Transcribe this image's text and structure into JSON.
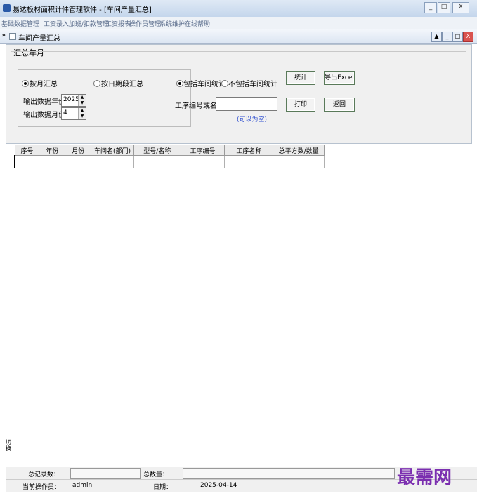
{
  "app": {
    "title": "易达板材面积计件管理软件  - [车间产量汇总]",
    "window_controls": {
      "minimize": "_",
      "maximize": "□",
      "close": "X"
    }
  },
  "menu": {
    "items": [
      "基础数据管理",
      "工资录入",
      "加班/扣款管理",
      "工资报表",
      "操作员管理",
      "系统维护",
      "在线帮助"
    ]
  },
  "child": {
    "nav": "»",
    "title": "车间产量汇总",
    "controls": {
      "restore": "▲",
      "minimize": "_",
      "maximize": "□",
      "close": "X"
    }
  },
  "form": {
    "group_title": "汇总年月",
    "radio_month": "按月汇总",
    "radio_date": "按日期段汇总",
    "year_label": "输出数据年份",
    "year_value": "2025",
    "month_label": "输出数据月份",
    "month_value": "4",
    "radio_include": "包括车间统计",
    "radio_exclude": "不包括车间统计",
    "process_label": "工序编号或名称",
    "process_hint": "(可以为空)",
    "stat_button": "统计",
    "excel_button": "导出Excel",
    "print_button": "打印",
    "back_button": "返回"
  },
  "table": {
    "headers": [
      "序号",
      "年份",
      "月份",
      "车间名(部门)",
      "型号/名称",
      "工序编号",
      "工序名称",
      "总平方数/数量"
    ]
  },
  "left_tab": "切换",
  "status": {
    "total_records_label": "总记录数：",
    "total_qty_label": "总数量：",
    "operator_label": "当前操作员：",
    "operator_value": "admin",
    "date_label": "日期：",
    "date_value": "2025-04-14"
  },
  "watermark": "最需网"
}
